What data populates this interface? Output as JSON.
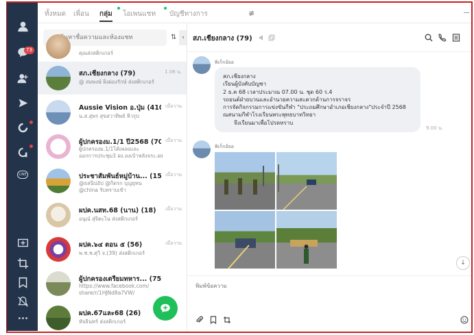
{
  "tabs": [
    {
      "label": "ทั้งหมด",
      "dot": false
    },
    {
      "label": "เพื่อน",
      "dot": false
    },
    {
      "label": "กลุ่ม",
      "dot": true,
      "active": true
    },
    {
      "label": "โอเพนแชท",
      "dot": true
    },
    {
      "label": "บัญชีทางการ",
      "dot": false
    }
  ],
  "rail": {
    "chat_badge": "73",
    "line_badge": "LINE"
  },
  "search": {
    "placeholder": "ค้นหาชื่อความและห้องแชท"
  },
  "chats": [
    {
      "name": "",
      "count": "",
      "preview": "คุณส่งสติกเกอร์",
      "preview2": "",
      "time": ""
    },
    {
      "name": "สภ.เชียงกลาง",
      "count": "(79)",
      "preview": "@ สมพงษ์ ผิงผ่องรักษ์ ส่งสติกเกอร์",
      "preview2": "",
      "time": "1.06 น.",
      "selected": true
    },
    {
      "name": "Aussie Vision อ.ปุ่ม",
      "count": "(410)",
      "preview": "น.ส.สุพร สุขสวาทิพย์ หิวรุป",
      "preview2": "",
      "time": "เมื่อวาน"
    },
    {
      "name": "ผู้ปกครองม.1/1 ปี2568",
      "count": "(70)",
      "preview": "ผู้ปกครองม.1/1ได้เพลงและ",
      "preview2": "ออกการประชุม3 ฝง.ลงเบ้าหลังจระ.ฝง",
      "time": "เมื่อวาน"
    },
    {
      "name": "ประชาสัมพันธ์หมู่บ้าน...",
      "count": "(155)",
      "preview": "@ธสนิปอัป @กิดรก บุญยุทน",
      "preview2": "@china รับทราบเข้า",
      "time": "เมื่อวาน"
    },
    {
      "name": "ผปค.นสท.68 (นาน)",
      "count": "(18)",
      "preview": "อนุณ์ สุ่จิตะไน ส่งสติกเกอร์",
      "preview2": "",
      "time": "เมื่อวาน"
    },
    {
      "name": "ผปค.๖๔ ตอน ๕",
      "count": "(56)",
      "preview": "พ.ช.ช.ศุวิ จ.(39) ส่งสติกเกอร์",
      "preview2": "",
      "time": "เมื่อวาน"
    },
    {
      "name": "ผู้ปกครองเตรียมทหาร...",
      "count": "(75)",
      "preview": "https://www.facebook.com/",
      "preview2": "share/r/1HJNd8a7VW/",
      "time": "เมื่อวาน"
    },
    {
      "name": "ผปค.67และ68",
      "count": "(26)",
      "preview": "หัจธินทร์ ส่งสติกเกอร์",
      "preview2": "",
      "time": "เมื่อวาน"
    }
  ],
  "chat": {
    "title": "สภ.เชียงกลาง (79)",
    "sender": "พิเก็กอ้ยอ",
    "message_lines": [
      "สภ.เชียงกลาง",
      "เรียนผู้บังคับบัญชา",
      "2 ธ.ค 68 เวลาประมาณ 07.00 น. ชุด 60 ร.4",
      "รถยนต์ฝ่ายบวนและอำนวยความสะดวกด้านการจราจร",
      "การจัดกิจกรรมการแข่งขันกีฬา \"ประถมศึกษาอำเภอเชียงกลาง\"ประจำปี 2568",
      "ณสนามกีฬาโรงเรียนพระพุทธบาทวิทยา",
      "จึงเรียนมาเพื่อโปรดทราบ"
    ],
    "message_time": "9.00 น.",
    "sender2": "พิเก็กอ้ยอ",
    "input_placeholder": "พิมพ์ข้อความ"
  },
  "colors": {
    "accent": "#1fbf5a",
    "rail": "#23334a",
    "badge": "#e0454b",
    "frame": "#c8201f"
  }
}
